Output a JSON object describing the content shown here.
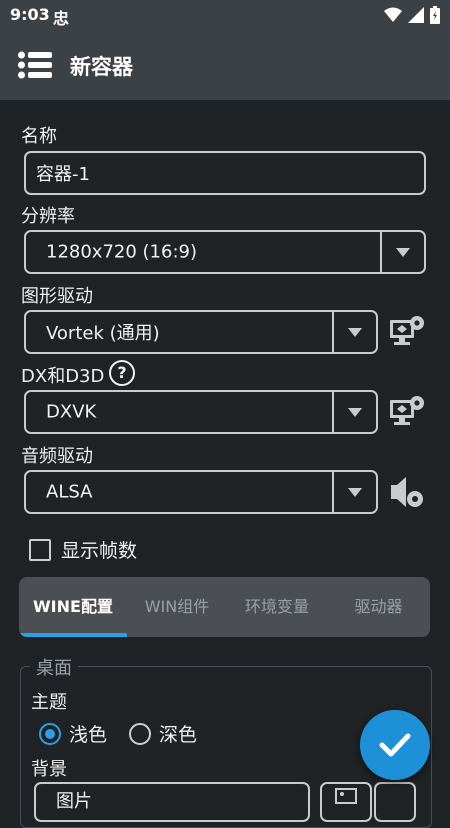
{
  "status_bar": {
    "time": "9:03",
    "icons": [
      "bug-icon",
      "wifi-icon",
      "signal-icon",
      "battery-icon"
    ]
  },
  "toolbar": {
    "title": "新容器",
    "menu_icon": "list-icon"
  },
  "name_field": {
    "label": "名称",
    "value": "容器-1"
  },
  "resolution": {
    "label": "分辨率",
    "value": "1280x720 (16:9)"
  },
  "graphics_driver": {
    "label": "图形驱动",
    "value": "Vortek (通用)",
    "icon": "monitor-settings-icon"
  },
  "dx_wrapper": {
    "label": "DX和D3D",
    "help_icon": "?",
    "value": "DXVK",
    "icon": "monitor-settings-icon"
  },
  "audio_driver": {
    "label": "音频驱动",
    "value": "ALSA",
    "icon": "speaker-settings-icon"
  },
  "show_fps": {
    "label": "显示帧数",
    "checked": false
  },
  "tabs": [
    {
      "label": "WINE配置",
      "active": true
    },
    {
      "label": "WIN组件",
      "active": false
    },
    {
      "label": "环境变量",
      "active": false
    },
    {
      "label": "驱动器",
      "active": false
    }
  ],
  "desktop": {
    "legend": "桌面",
    "theme_label": "主题",
    "theme_options": [
      {
        "label": "浅色",
        "selected": true
      },
      {
        "label": "深色",
        "selected": false
      }
    ],
    "background_label": "背景",
    "background_value": "图片"
  },
  "colors": {
    "accent": "#2aa0e6",
    "fab": "#1e90d8",
    "bar": "#3c4146",
    "bg": "#1f2326"
  }
}
